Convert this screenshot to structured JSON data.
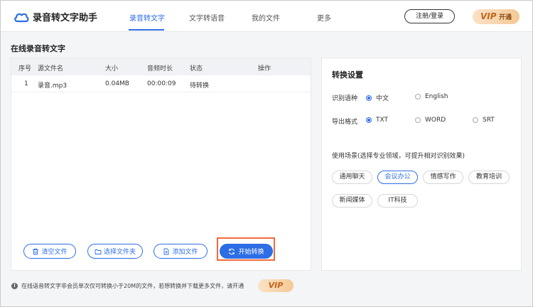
{
  "header": {
    "app_name": "录音转文字助手",
    "nav": [
      "录音转文字",
      "文字转语音",
      "我的文件",
      "更多"
    ],
    "login_label": "注册/登录",
    "vip_mark": "VIP",
    "vip_label": "开通"
  },
  "section_title": "在线录音转文字",
  "table": {
    "headers": [
      "序号",
      "源文件名",
      "大小",
      "音频时长",
      "状态",
      "操作"
    ],
    "rows": [
      {
        "index": "1",
        "name": "录音.mp3",
        "size": "0.04MB",
        "duration": "00:00:09",
        "status": "待转换"
      }
    ]
  },
  "actions": {
    "clear": "清空文件",
    "choose_folder": "选择文件夹",
    "add_file": "添加文件",
    "convert": "开始转换"
  },
  "settings": {
    "title": "转换设置",
    "language_label": "识别语种",
    "languages": [
      "中文",
      "English"
    ],
    "language_selected": "中文",
    "format_label": "导出格式",
    "formats": [
      "TXT",
      "WORD",
      "SRT"
    ],
    "format_selected": "TXT",
    "scene_desc": "使用场景(选择专业领域，可提升相对识别效果)",
    "scenes": [
      "通用聊天",
      "会议办公",
      "情感写作",
      "教育培训",
      "新闻媒体",
      "IT科技"
    ],
    "scene_selected": "会议办公"
  },
  "notice": {
    "text": "在线语音转文字非会员单次仅可转换小于20M的文件，若想转换并下载更多文件，请开通",
    "vip_label": "VIP"
  },
  "colors": {
    "accent": "#2d6ee6",
    "highlight": "#f06b3a",
    "vip_gold": "#f4c996"
  }
}
